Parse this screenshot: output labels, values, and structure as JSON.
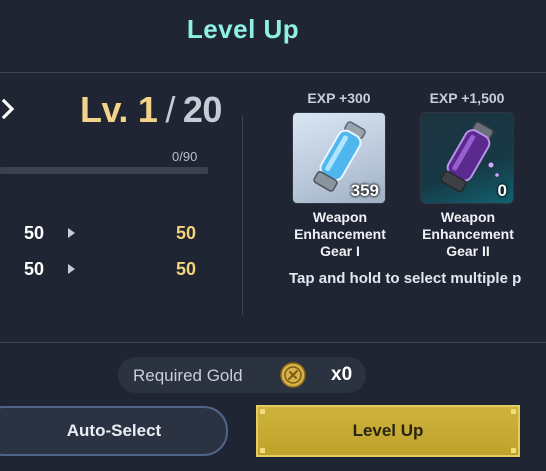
{
  "title": "Level Up",
  "level": {
    "prefix": "Lv.",
    "current": "1",
    "separator": "/",
    "max": "20"
  },
  "exp": {
    "text": "0/90",
    "progress": 0.0
  },
  "stats": [
    {
      "from": "50",
      "to": "50"
    },
    {
      "from": "50",
      "to": "50"
    }
  ],
  "items": [
    {
      "exp_label": "EXP +300",
      "quantity": "359",
      "name_lines": [
        "Weapon",
        "Enhancement",
        "Gear I"
      ]
    },
    {
      "exp_label": "EXP +1,500",
      "quantity": "0",
      "name_lines": [
        "Weapon",
        "Enhancement",
        "Gear II"
      ]
    }
  ],
  "hint": "Tap and hold to select multiple p",
  "gold": {
    "label": "Required Gold",
    "quantity": "x0"
  },
  "buttons": {
    "auto_select": "Auto-Select",
    "level_up": "Level Up"
  },
  "colors": {
    "title": "#8ff0e4",
    "accent_gold": "#f3d27c",
    "level_button": "#c8ad36"
  }
}
